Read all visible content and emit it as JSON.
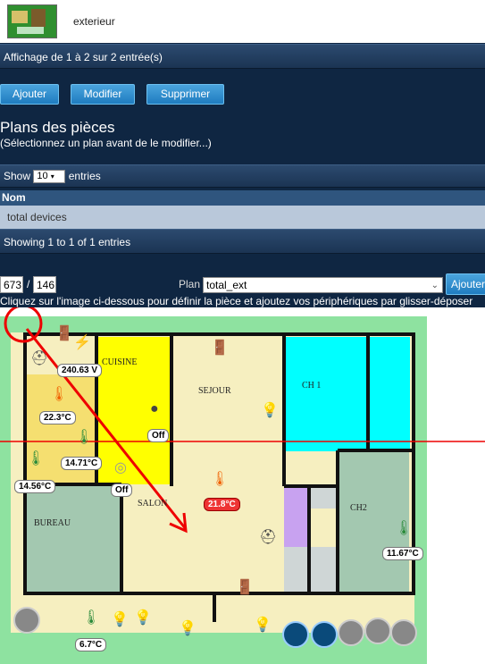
{
  "top_row": {
    "name": "exterieur"
  },
  "table1": {
    "info": "Affichage de 1 à 2 sur 2 entrée(s)"
  },
  "actions": {
    "add": "Ajouter",
    "edit": "Modifier",
    "delete": "Supprimer"
  },
  "plans": {
    "title": "Plans des pièces",
    "subtitle": "(Sélectionnez un plan avant de le modifier...)",
    "show_prefix": "Show",
    "show_value": "10",
    "show_suffix": "entries",
    "column": "Nom",
    "rows": [
      "total devices"
    ],
    "info": "Showing 1 to 1 of 1 entries"
  },
  "editor": {
    "x": "673",
    "sep": "/",
    "y": "146",
    "plan_label": "Plan",
    "plan_value": "total_ext",
    "add_button": "Ajouter",
    "hint": "Cliquez sur l'image ci-dessous pour définir la pièce et ajoutez vos périphériques par glisser-déposer"
  },
  "rooms": {
    "cuisine": "CUISINE",
    "sejour": "SEJOUR",
    "ch1": "CH 1",
    "salon": "SALON",
    "bureau": "BUREAU",
    "ch2": "CH2"
  },
  "devices": {
    "voltage": "240.63 V",
    "temp_kitchen": "22.3°C",
    "switch1": "Off",
    "hum_1": "14.71°C",
    "hum_2": "14.56°C",
    "switch2": "Off",
    "temp_salon": "21.8°C",
    "temp_ch2": "11.67°C",
    "temp_bottom": "6.7°C"
  },
  "colors": {
    "header_bg": "#0f2642",
    "button": "#2a8ad0",
    "plan_border": "#8ee2a0",
    "kitchen": "#ffff00",
    "ch1": "#00ffff",
    "floor": "#f6efc0",
    "bureau": "#a3c8b0"
  }
}
